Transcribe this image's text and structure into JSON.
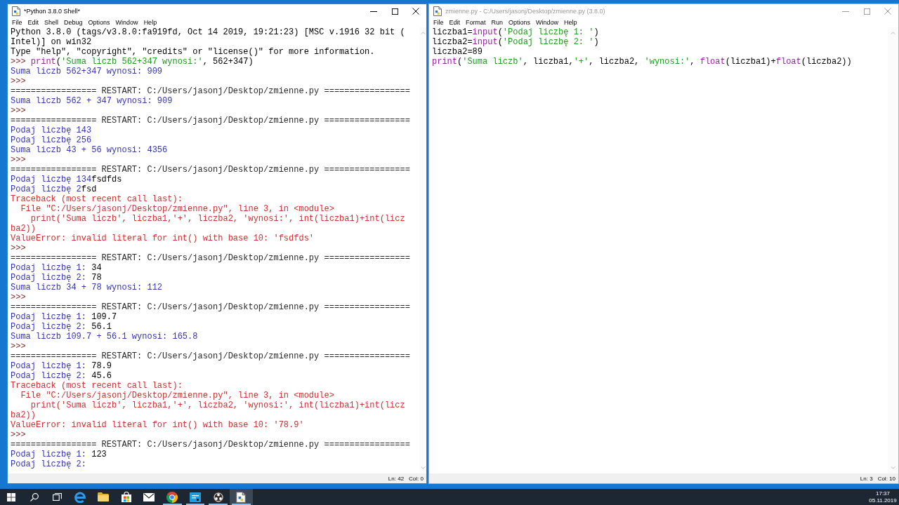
{
  "desktop": {
    "windows": [
      {
        "kind": "shell",
        "title": "*Python 3.8.0 Shell*",
        "active": true,
        "menu": [
          "File",
          "Edit",
          "Shell",
          "Debug",
          "Options",
          "Window",
          "Help"
        ],
        "lines": [
          {
            "segments": [
              {
                "kind": "plain",
                "text": "Python 3.8.0 (tags/v3.8.0:fa919fd, Oct 14 2019, 19:21:23) [MSC v.1916 32 bit ("
              }
            ]
          },
          {
            "segments": [
              {
                "kind": "plain",
                "text": "Intel)] on win32"
              }
            ]
          },
          {
            "segments": [
              {
                "kind": "plain",
                "text": "Type \"help\", \"copyright\", \"credits\" or \"license()\" for more information."
              }
            ]
          },
          {
            "segments": [
              {
                "kind": "prompt",
                "text": ">>> "
              },
              {
                "kind": "builtin",
                "text": "print"
              },
              {
                "kind": "plain",
                "text": "("
              },
              {
                "kind": "string",
                "text": "'Suma liczb 562+347 wynosi:'"
              },
              {
                "kind": "plain",
                "text": ", 562+347)"
              }
            ]
          },
          {
            "segments": [
              {
                "kind": "stdout",
                "text": "Suma liczb 562+347 wynosi: 909"
              }
            ]
          },
          {
            "segments": [
              {
                "kind": "prompt",
                "text": ">>>"
              }
            ]
          },
          {
            "segments": [
              {
                "kind": "console",
                "text": "================= RESTART: C:/Users/jasonj/Desktop/zmienne.py ================="
              }
            ]
          },
          {
            "segments": [
              {
                "kind": "stdout",
                "text": "Suma liczb 562 + 347 wynosi: 909"
              }
            ]
          },
          {
            "segments": [
              {
                "kind": "prompt",
                "text": ">>>"
              }
            ]
          },
          {
            "segments": [
              {
                "kind": "console",
                "text": "================= RESTART: C:/Users/jasonj/Desktop/zmienne.py ================="
              }
            ]
          },
          {
            "segments": [
              {
                "kind": "stdout",
                "text": "Podaj liczbę 143"
              }
            ]
          },
          {
            "segments": [
              {
                "kind": "stdout",
                "text": "Podaj liczbę 256"
              }
            ]
          },
          {
            "segments": [
              {
                "kind": "stdout",
                "text": "Suma liczb 43 + 56 wynosi: 4356"
              }
            ]
          },
          {
            "segments": [
              {
                "kind": "prompt",
                "text": ">>>"
              }
            ]
          },
          {
            "segments": [
              {
                "kind": "console",
                "text": "================= RESTART: C:/Users/jasonj/Desktop/zmienne.py ================="
              }
            ]
          },
          {
            "segments": [
              {
                "kind": "stdout",
                "text": "Podaj liczbę 134"
              },
              {
                "kind": "stdin",
                "text": "fsdfds"
              }
            ]
          },
          {
            "segments": [
              {
                "kind": "stdout",
                "text": "Podaj liczbę 2"
              },
              {
                "kind": "stdin",
                "text": "fsd"
              }
            ]
          },
          {
            "segments": [
              {
                "kind": "stderr",
                "text": "Traceback (most recent call last):"
              }
            ]
          },
          {
            "segments": [
              {
                "kind": "stderr",
                "text": "  File \"C:/Users/jasonj/Desktop/zmienne.py\", line 3, in <module>"
              }
            ]
          },
          {
            "segments": [
              {
                "kind": "stderr",
                "text": "    print('Suma liczb', liczba1,'+', liczba2, 'wynosi:', int(liczba1)+int(licz"
              }
            ]
          },
          {
            "segments": [
              {
                "kind": "stderr",
                "text": "ba2))"
              }
            ]
          },
          {
            "segments": [
              {
                "kind": "stderr",
                "text": "ValueError: invalid literal for int() with base 10: 'fsdfds'"
              }
            ]
          },
          {
            "segments": [
              {
                "kind": "prompt",
                "text": ">>>"
              }
            ]
          },
          {
            "segments": [
              {
                "kind": "console",
                "text": "================= RESTART: C:/Users/jasonj/Desktop/zmienne.py ================="
              }
            ]
          },
          {
            "segments": [
              {
                "kind": "stdout",
                "text": "Podaj liczbę 1: "
              },
              {
                "kind": "stdin",
                "text": "34"
              }
            ]
          },
          {
            "segments": [
              {
                "kind": "stdout",
                "text": "Podaj liczbę 2: "
              },
              {
                "kind": "stdin",
                "text": "78"
              }
            ]
          },
          {
            "segments": [
              {
                "kind": "stdout",
                "text": "Suma liczb 34 + 78 wynosi: 112"
              }
            ]
          },
          {
            "segments": [
              {
                "kind": "prompt",
                "text": ">>>"
              }
            ]
          },
          {
            "segments": [
              {
                "kind": "console",
                "text": "================= RESTART: C:/Users/jasonj/Desktop/zmienne.py ================="
              }
            ]
          },
          {
            "segments": [
              {
                "kind": "stdout",
                "text": "Podaj liczbę 1: "
              },
              {
                "kind": "stdin",
                "text": "109.7"
              }
            ]
          },
          {
            "segments": [
              {
                "kind": "stdout",
                "text": "Podaj liczbę 2: "
              },
              {
                "kind": "stdin",
                "text": "56.1"
              }
            ]
          },
          {
            "segments": [
              {
                "kind": "stdout",
                "text": "Suma liczb 109.7 + 56.1 wynosi: 165.8"
              }
            ]
          },
          {
            "segments": [
              {
                "kind": "prompt",
                "text": ">>>"
              }
            ]
          },
          {
            "segments": [
              {
                "kind": "console",
                "text": "================= RESTART: C:/Users/jasonj/Desktop/zmienne.py ================="
              }
            ]
          },
          {
            "segments": [
              {
                "kind": "stdout",
                "text": "Podaj liczbę 1: "
              },
              {
                "kind": "stdin",
                "text": "78.9"
              }
            ]
          },
          {
            "segments": [
              {
                "kind": "stdout",
                "text": "Podaj liczbę 2: "
              },
              {
                "kind": "stdin",
                "text": "45.6"
              }
            ]
          },
          {
            "segments": [
              {
                "kind": "stderr",
                "text": "Traceback (most recent call last):"
              }
            ]
          },
          {
            "segments": [
              {
                "kind": "stderr",
                "text": "  File \"C:/Users/jasonj/Desktop/zmienne.py\", line 3, in <module>"
              }
            ]
          },
          {
            "segments": [
              {
                "kind": "stderr",
                "text": "    print('Suma liczb', liczba1,'+', liczba2, 'wynosi:', int(liczba1)+int(licz"
              }
            ]
          },
          {
            "segments": [
              {
                "kind": "stderr",
                "text": "ba2))"
              }
            ]
          },
          {
            "segments": [
              {
                "kind": "stderr",
                "text": "ValueError: invalid literal for int() with base 10: '78.9'"
              }
            ]
          },
          {
            "segments": [
              {
                "kind": "prompt",
                "text": ">>>"
              }
            ]
          },
          {
            "segments": [
              {
                "kind": "console",
                "text": "================= RESTART: C:/Users/jasonj/Desktop/zmienne.py ================="
              }
            ]
          },
          {
            "segments": [
              {
                "kind": "stdout",
                "text": "Podaj liczbę 1: "
              },
              {
                "kind": "stdin",
                "text": "123"
              }
            ]
          },
          {
            "segments": [
              {
                "kind": "stdout",
                "text": "Podaj liczbę 2:"
              }
            ]
          }
        ],
        "status": {
          "line": "Ln: 42",
          "column": "Col: 0"
        }
      },
      {
        "kind": "editor",
        "title": "zmienne.py - C:/Users/jasonj/Desktop/zmienne.py (3.8.0)",
        "active": false,
        "menu": [
          "File",
          "Edit",
          "Format",
          "Run",
          "Options",
          "Window",
          "Help"
        ],
        "lines": [
          {
            "segments": [
              {
                "kind": "plain",
                "text": "liczba1="
              },
              {
                "kind": "builtin",
                "text": "input"
              },
              {
                "kind": "plain",
                "text": "("
              },
              {
                "kind": "string",
                "text": "'Podaj liczbę 1: '"
              },
              {
                "kind": "plain",
                "text": ")"
              }
            ]
          },
          {
            "segments": [
              {
                "kind": "plain",
                "text": "liczba2="
              },
              {
                "kind": "builtin",
                "text": "input"
              },
              {
                "kind": "plain",
                "text": "("
              },
              {
                "kind": "string",
                "text": "'Podaj liczbę 2: '"
              },
              {
                "kind": "plain",
                "text": ")"
              }
            ]
          },
          {
            "segments": [
              {
                "kind": "plain",
                "text": "liczba2=89"
              }
            ]
          },
          {
            "segments": [
              {
                "kind": "builtin",
                "text": "print"
              },
              {
                "kind": "plain",
                "text": "("
              },
              {
                "kind": "string",
                "text": "'Suma liczb'"
              },
              {
                "kind": "plain",
                "text": ", liczba1,"
              },
              {
                "kind": "string",
                "text": "'+'"
              },
              {
                "kind": "plain",
                "text": ", liczba2, "
              },
              {
                "kind": "string",
                "text": "'wynosi:'"
              },
              {
                "kind": "plain",
                "text": ", "
              },
              {
                "kind": "builtin",
                "text": "float"
              },
              {
                "kind": "plain",
                "text": "(liczba1)+"
              },
              {
                "kind": "builtin",
                "text": "float"
              },
              {
                "kind": "plain",
                "text": "(liczba2))"
              }
            ]
          }
        ],
        "status": {
          "line": "Ln: 3",
          "column": "Col: 10"
        }
      }
    ]
  },
  "taskbar": {
    "buttons": [
      {
        "kind": "start"
      },
      {
        "kind": "search"
      },
      {
        "kind": "taskview"
      }
    ],
    "apps": [
      {
        "kind": "elogo",
        "running": false,
        "selected": false
      },
      {
        "kind": "folder",
        "running": false,
        "selected": false
      },
      {
        "kind": "bag",
        "running": false,
        "selected": false
      },
      {
        "kind": "envelope",
        "running": false,
        "selected": false
      },
      {
        "kind": "tricolor",
        "running": true,
        "selected": false
      },
      {
        "kind": "tile",
        "running": true,
        "selected": false
      },
      {
        "kind": "disc",
        "running": true,
        "selected": false
      },
      {
        "kind": "document",
        "running": true,
        "selected": true
      }
    ],
    "clock": {
      "time": "17:37",
      "date": "05.11.2019"
    }
  }
}
